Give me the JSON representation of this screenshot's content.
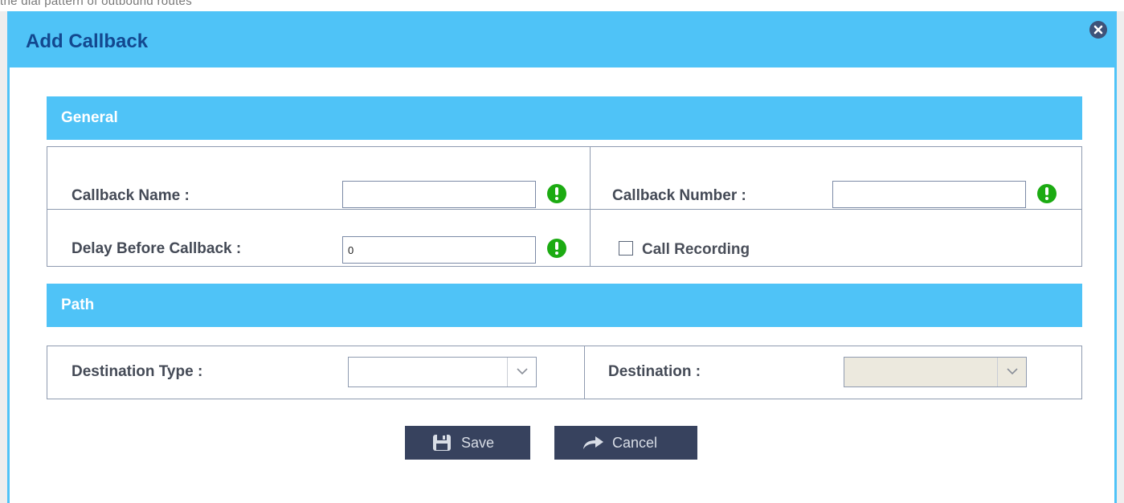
{
  "background": {
    "partial_text": "the dial pattern of outbound routes"
  },
  "dialog": {
    "title": "Add Callback"
  },
  "general": {
    "title": "General",
    "callback_name_label": "Callback Name :",
    "callback_name_value": "",
    "callback_number_label": "Callback Number :",
    "callback_number_value": "",
    "delay_label": "Delay Before Callback :",
    "delay_value": "0",
    "call_recording_label": "Call Recording",
    "call_recording_checked": false
  },
  "path": {
    "title": "Path",
    "destination_type_label": "Destination Type :",
    "destination_type_value": "",
    "destination_label": "Destination :",
    "destination_value": ""
  },
  "buttons": {
    "save_label": "Save",
    "cancel_label": "Cancel"
  },
  "colors": {
    "accent": "#4fc3f7",
    "title_text": "#13488f",
    "button_bg": "#37425e",
    "required_icon": "#1cab12"
  }
}
